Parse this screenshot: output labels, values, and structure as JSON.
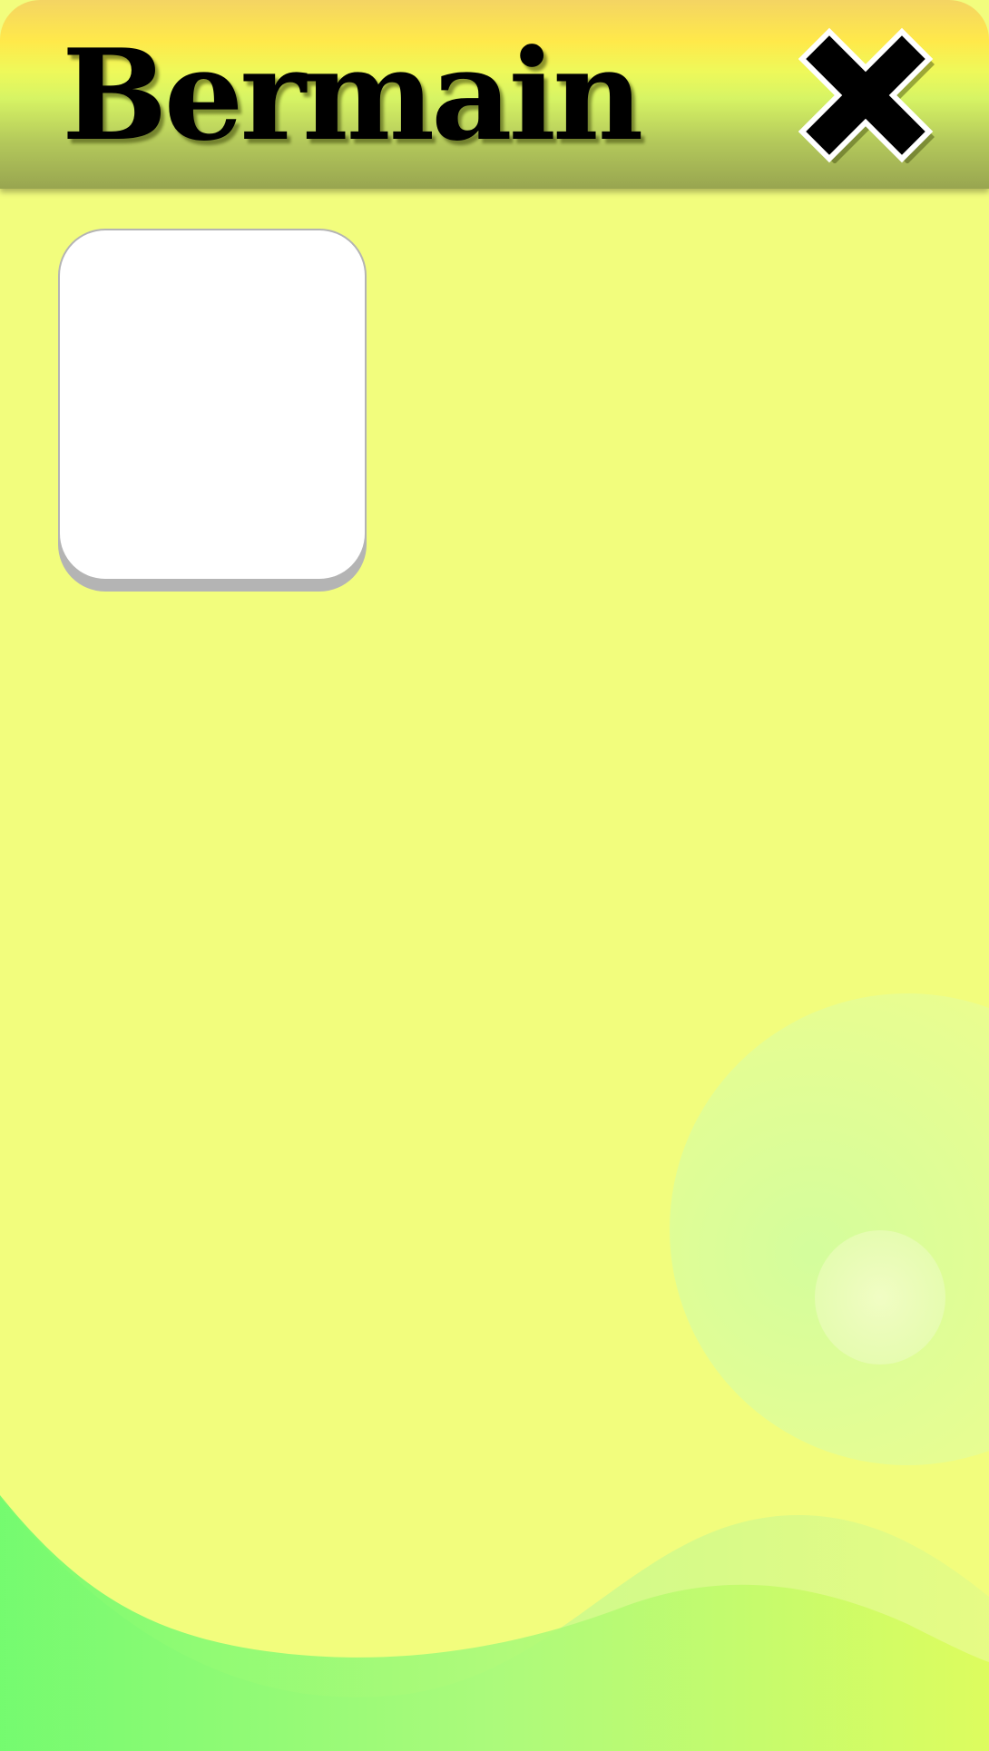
{
  "dialog": {
    "title": "Bermain",
    "close_icon": "close-x-icon"
  },
  "slots": [
    {
      "state": "empty"
    }
  ],
  "colors": {
    "background": "#f2fd7d",
    "header_top": "#f4d463",
    "header_mid": "#ffe94a",
    "header_bottom": "#98a550",
    "wave": "#7dfc6f",
    "card": "#ffffff"
  }
}
